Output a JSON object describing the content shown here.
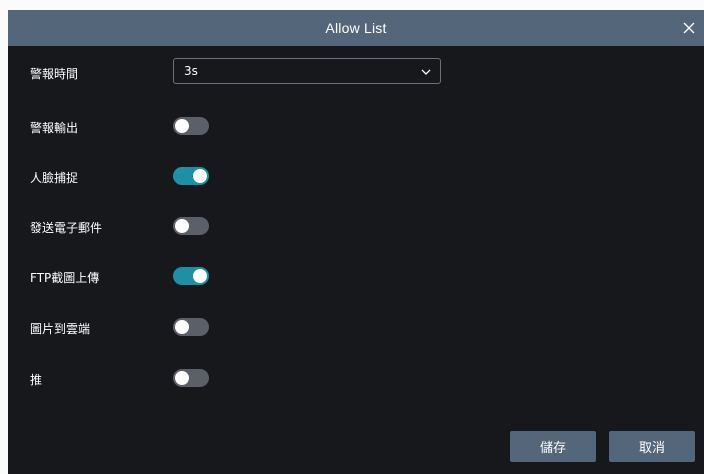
{
  "dialog": {
    "title": "Allow List",
    "alarm_time": {
      "label": "警報時間",
      "selected_value": "3s"
    },
    "toggles": [
      {
        "label": "警報輸出",
        "state": "off"
      },
      {
        "label": "人臉捕捉",
        "state": "on"
      },
      {
        "label": "發送電子郵件",
        "state": "off"
      },
      {
        "label": "FTP截圖上傳",
        "state": "on"
      },
      {
        "label": "圖片到雲端",
        "state": "off"
      },
      {
        "label": "推",
        "state": "off"
      }
    ],
    "buttons": {
      "save_label": "儲存",
      "cancel_label": "取消"
    }
  },
  "colors": {
    "titlebar": "#53667a",
    "dialog_bg": "#17181c",
    "toggle_on": "#1f8fa5",
    "toggle_off": "#5b5f67",
    "button_bg": "#53667a"
  },
  "icons": {
    "close": "close-icon",
    "dropdown": "chevron-down-icon"
  }
}
